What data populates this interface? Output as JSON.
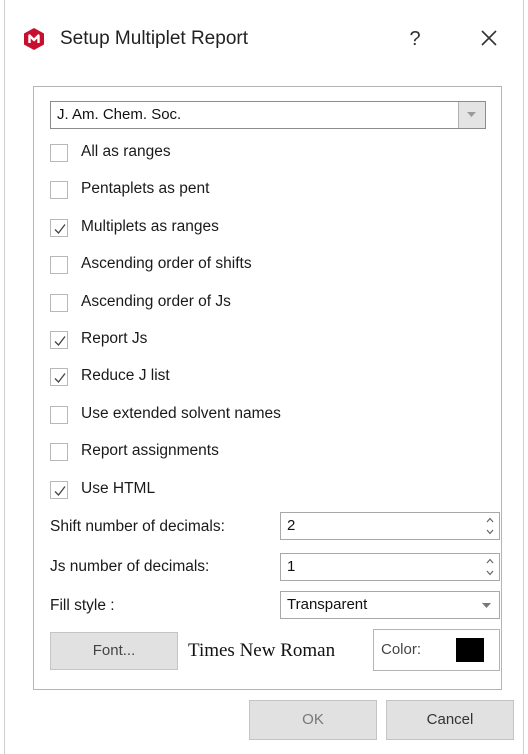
{
  "window": {
    "title": "Setup Multiplet Report",
    "help_label": "?",
    "app_icon": "mnova-logo-icon",
    "close_icon": "close-icon"
  },
  "journal_combo": {
    "value": "J. Am. Chem. Soc."
  },
  "options": [
    {
      "label": "All as ranges",
      "checked": false
    },
    {
      "label": "Pentaplets as pent",
      "checked": false
    },
    {
      "label": "Multiplets as ranges",
      "checked": true
    },
    {
      "label": "Ascending order of shifts",
      "checked": false
    },
    {
      "label": "Ascending order of Js",
      "checked": false
    },
    {
      "label": "Report Js",
      "checked": true
    },
    {
      "label": "Reduce J list",
      "checked": true
    },
    {
      "label": "Use extended solvent names",
      "checked": false
    },
    {
      "label": "Report assignments",
      "checked": false
    },
    {
      "label": "Use HTML",
      "checked": true
    }
  ],
  "shift_decimals": {
    "label": "Shift number of decimals:",
    "value": "2"
  },
  "js_decimals": {
    "label": "Js number of decimals:",
    "value": "1"
  },
  "fill_style": {
    "label": "Fill style :",
    "value": "Transparent"
  },
  "font": {
    "button_label": "Font...",
    "name": "Times New Roman"
  },
  "color": {
    "label": "Color:",
    "value": "#000000"
  },
  "buttons": {
    "ok": "OK",
    "cancel": "Cancel"
  },
  "colors": {
    "brand": "#c8102e",
    "check": "#444444"
  }
}
